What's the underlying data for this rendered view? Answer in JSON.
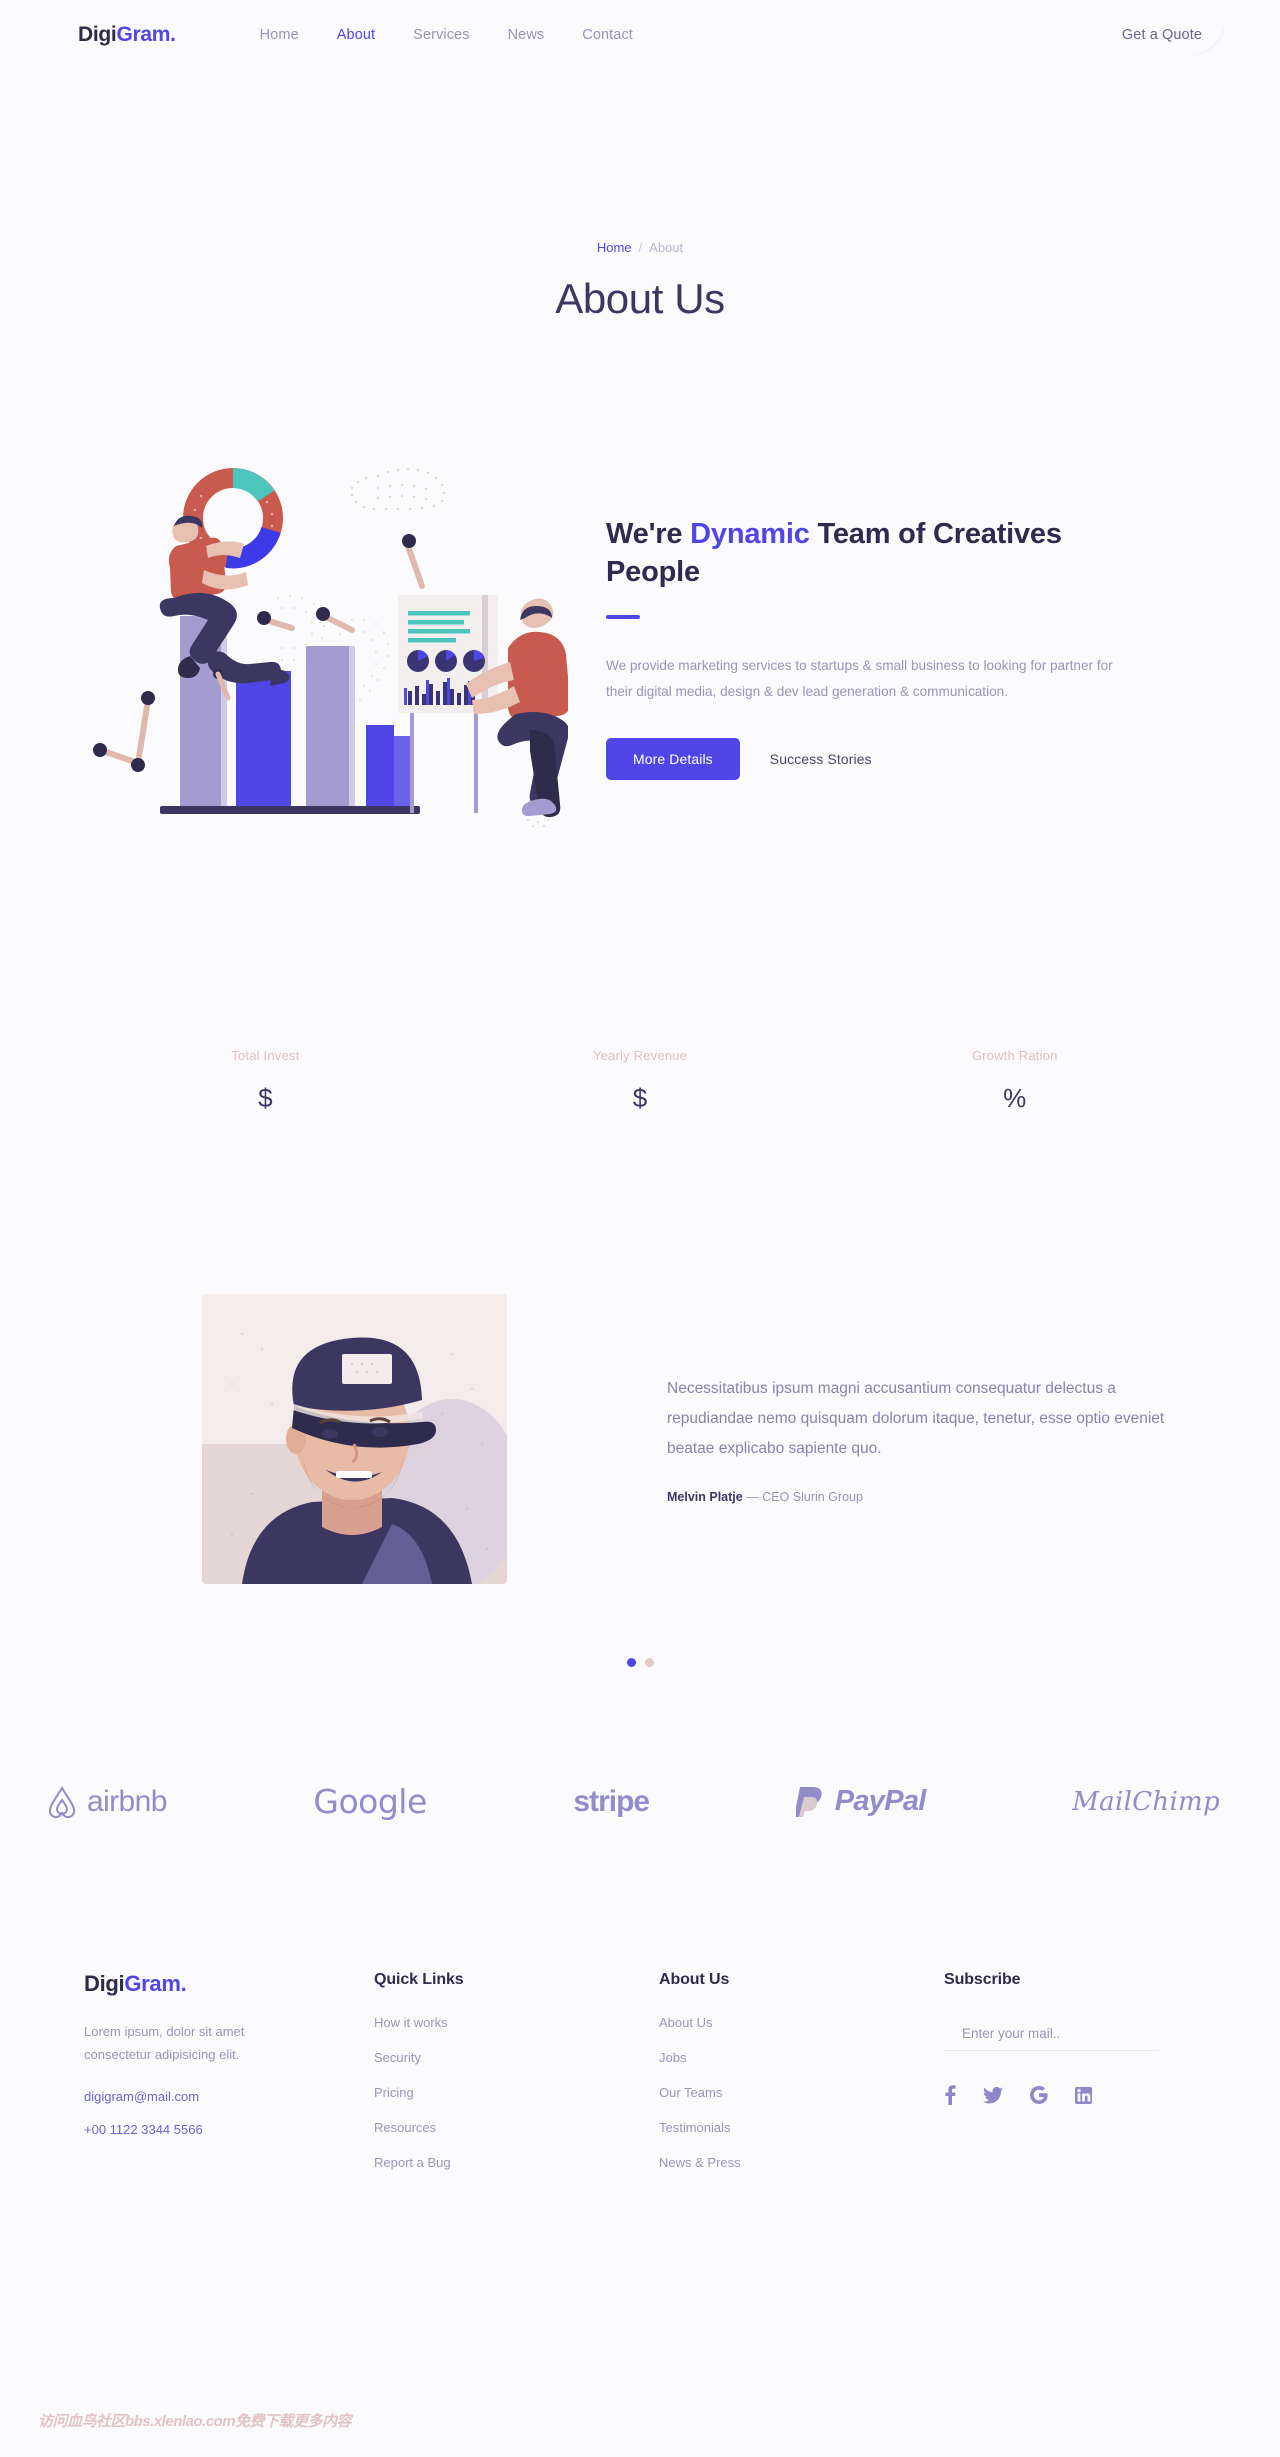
{
  "header": {
    "logo_prefix": "Digi",
    "logo_accent": "Gram.",
    "nav": [
      {
        "label": "Home",
        "active": false
      },
      {
        "label": "About",
        "active": true
      },
      {
        "label": "Services",
        "active": false
      },
      {
        "label": "News",
        "active": false
      },
      {
        "label": "Contact",
        "active": false
      }
    ],
    "quote_label": "Get a Quote"
  },
  "page_head": {
    "breadcrumb_home": "Home",
    "breadcrumb_sep": "/",
    "breadcrumb_current": "About",
    "title": "About Us"
  },
  "hero": {
    "title_part1": "We're ",
    "title_accent": "Dynamic",
    "title_part2": " Team of Creatives People",
    "paragraph": "We provide marketing services to startups & small business to looking for partner for their digital media, design & dev lead generation & communication.",
    "primary_button": "More Details",
    "secondary_button": "Success Stories"
  },
  "stats": [
    {
      "label": "Total Invest",
      "value": "$"
    },
    {
      "label": "Yearly Revenue",
      "value": "$"
    },
    {
      "label": "Growth Ration",
      "value": "%"
    }
  ],
  "testimonial": {
    "quote": "Necessitatibus ipsum magni accusantium consequatur delectus a repudiandae nemo quisquam dolorum itaque, tenetur, esse optio eveniet beatae explicabo sapiente quo.",
    "author_name": "Melvin Platje",
    "author_dash": " — ",
    "author_role": "CEO Slurin Group",
    "dots": [
      true,
      false
    ]
  },
  "brands": [
    {
      "name": "airbnb",
      "icon": "airbnb-icon"
    },
    {
      "name": "Google",
      "icon": "google-wordmark"
    },
    {
      "name": "stripe",
      "icon": "stripe-wordmark"
    },
    {
      "name": "PayPal",
      "icon": "paypal-icon"
    },
    {
      "name": "MailChimp",
      "icon": "mailchimp-wordmark"
    }
  ],
  "footer": {
    "logo_prefix": "Digi",
    "logo_accent": "Gram.",
    "description": "Lorem ipsum, dolor sit amet consectetur adipisicing elit.",
    "email": "digigram@mail.com",
    "phone": "+00 1122 3344 5566",
    "quick_links": {
      "heading": "Quick Links",
      "items": [
        "How it works",
        "Security",
        "Pricing",
        "Resources",
        "Report a Bug"
      ]
    },
    "about": {
      "heading": "About Us",
      "items": [
        "About Us",
        "Jobs",
        "Our Teams",
        "Testimonials",
        "News & Press"
      ]
    },
    "subscribe": {
      "heading": "Subscribe",
      "placeholder": "Enter your mail..",
      "value": "",
      "socials": [
        {
          "name": "facebook-icon"
        },
        {
          "name": "twitter-icon"
        },
        {
          "name": "google-icon"
        },
        {
          "name": "linkedin-icon"
        }
      ]
    }
  },
  "watermark": "访问血鸟社区bbs.xlenlao.com免费下载更多内容",
  "colors": {
    "accent": "#5046e8",
    "background": "#fbfbfe",
    "text_dark": "#3b3761",
    "text_muted": "#9a95b8",
    "stat_label": "#e0bfbb",
    "brand_logo": "#8e87c9"
  }
}
